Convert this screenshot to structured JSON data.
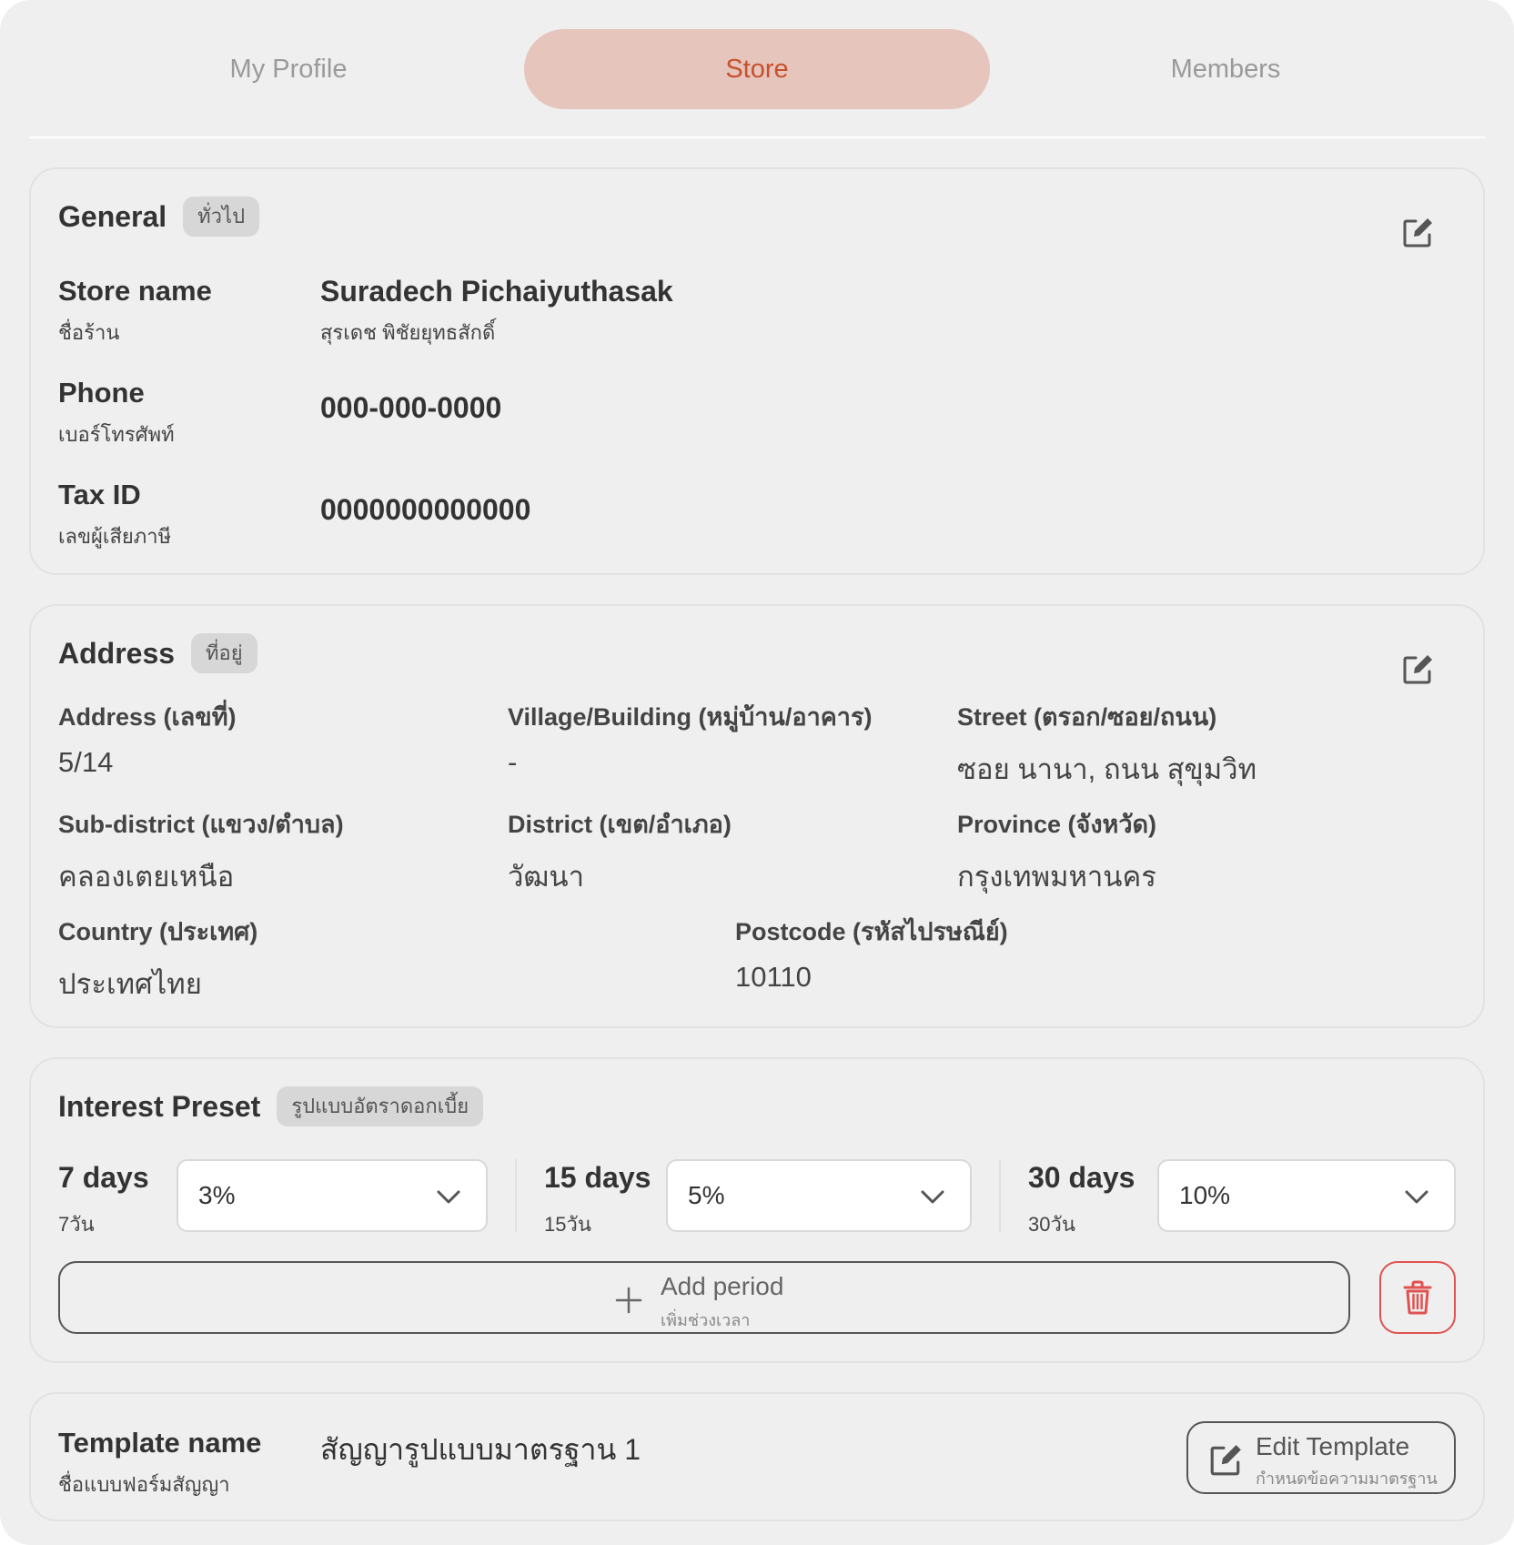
{
  "tabs": [
    {
      "label": "My Profile",
      "active": false
    },
    {
      "label": "Store",
      "active": true
    },
    {
      "label": "Members",
      "active": false
    }
  ],
  "colors": {
    "background": "#efefef",
    "active_tab_bg": "#e6c5bc",
    "active_tab_text": "#c9502c",
    "inactive_tab_text": "#9a9a9a",
    "delete_accent": "#e05252"
  },
  "general": {
    "title": "General",
    "badge": "ทั่วไป",
    "edit_icon": "edit-icon",
    "fields": [
      {
        "label": "Store name",
        "sublabel": "ชื่อร้าน",
        "value": "Suradech Pichaiyuthasak",
        "subvalue": "สุรเดช พิชัยยุทธสักดิ์"
      },
      {
        "label": "Phone",
        "sublabel": "เบอร์โทรศัพท์",
        "value": "000-000-0000"
      },
      {
        "label": "Tax ID",
        "sublabel": "เลขผู้เสียภาษี",
        "value": "0000000000000"
      }
    ]
  },
  "address": {
    "title": "Address",
    "badge": "ที่อยู่",
    "edit_icon": "edit-icon",
    "fields": [
      {
        "label": "Address (เลขที่)",
        "value": "5/14"
      },
      {
        "label": "Village/Building (หมู่บ้าน/อาคาร)",
        "value": "-"
      },
      {
        "label": "Street (ตรอก/ซอย/ถนน)",
        "value": "ซอย นานา, ถนน สุขุมวิท"
      },
      {
        "label": "Sub-district (แขวง/ตำบล)",
        "value": "คลองเตยเหนือ"
      },
      {
        "label": "District (เขต/อำเภอ)",
        "value": "วัฒนา"
      },
      {
        "label": "Province (จังหวัด)",
        "value": "กรุงเทพมหานคร"
      },
      {
        "label": "Country (ประเทศ)",
        "value": "ประเทศไทย"
      },
      {
        "label": "Postcode (รหัสไปรษณีย์)",
        "value": "10110"
      }
    ]
  },
  "interest": {
    "title": "Interest Preset",
    "badge": "รูปแบบอัตราดอกเบี้ย",
    "periods": [
      {
        "days": "7 days",
        "days_th": "7วัน",
        "rate": "3%"
      },
      {
        "days": "15 days",
        "days_th": "15วัน",
        "rate": "5%"
      },
      {
        "days": "30 days",
        "days_th": "30วัน",
        "rate": "10%"
      }
    ],
    "add_period": {
      "label": "Add period",
      "sublabel": "เพิ่มช่วงเวลา",
      "icon": "plus-icon"
    },
    "delete_icon": "trash-icon"
  },
  "template": {
    "label": "Template name",
    "sublabel": "ชื่อแบบฟอร์มสัญญา",
    "value": "สัญญารูปแบบมาตรฐาน 1",
    "edit_button": {
      "label": "Edit Template",
      "sublabel": "กำหนดข้อความมาตรฐาน",
      "icon": "edit-icon"
    }
  }
}
